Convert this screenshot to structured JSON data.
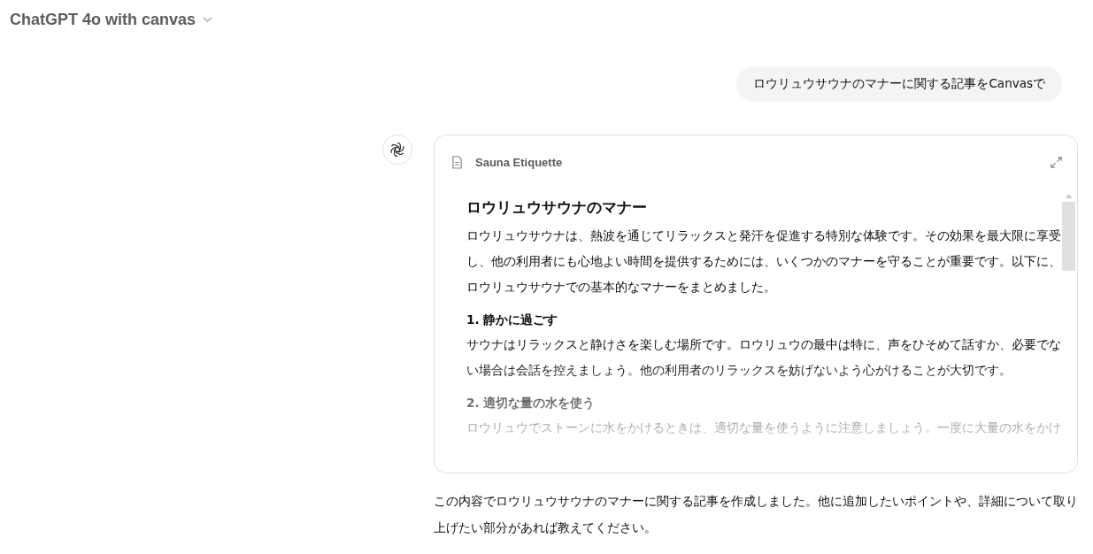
{
  "header": {
    "title": "ChatGPT 4o with canvas"
  },
  "user_message": "ロウリュウサウナのマナーに関する記事をCanvasで",
  "canvas": {
    "title": "Sauna Etiquette",
    "blocks": [
      {
        "kind": "heading",
        "text": "ロウリュウサウナのマナー"
      },
      {
        "kind": "paragraph",
        "text": "ロウリュウサウナは、熱波を通じてリラックスと発汗を促進する特別な体験です。その効果を最大限に享受し、他の利用者にも心地よい時間を提供するためには、いくつかのマナーを守ることが重要です。以下に、ロウリュウサウナでの基本的なマナーをまとめました。"
      },
      {
        "kind": "subheading",
        "text": "1. 静かに過ごす"
      },
      {
        "kind": "paragraph",
        "text": "サウナはリラックスと静けさを楽しむ場所です。ロウリュウの最中は特に、声をひそめて話すか、必要でない場合は会話を控えましょう。他の利用者のリラックスを妨げないよう心がけることが大切です。"
      },
      {
        "kind": "subheading",
        "text": "2. 適切な量の水を使う"
      },
      {
        "kind": "paragraph",
        "text": "ロウリュウでストーンに水をかけるときは、適切な量を使うように注意しましょう。一度に大量の水をかけ"
      }
    ]
  },
  "assistant_message": "この内容でロウリュウサウナのマナーに関する記事を作成しました。他に追加したいポイントや、詳細について取り上げたい部分があれば教えてください。"
}
